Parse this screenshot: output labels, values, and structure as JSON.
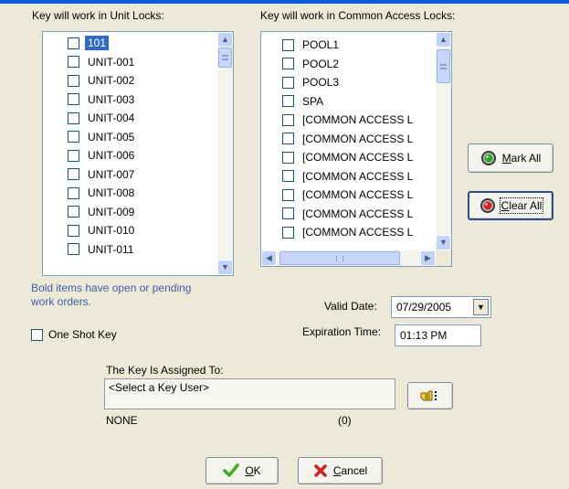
{
  "unit_locks": {
    "heading": "Key will work in Unit Locks:",
    "items": [
      "101",
      "UNIT-001",
      "UNIT-002",
      "UNIT-003",
      "UNIT-004",
      "UNIT-005",
      "UNIT-006",
      "UNIT-007",
      "UNIT-008",
      "UNIT-009",
      "UNIT-010",
      "UNIT-011"
    ],
    "selected": "101"
  },
  "common_locks": {
    "heading": "Key will work in Common Access Locks:",
    "items": [
      "POOL1",
      "POOL2",
      "POOL3",
      "SPA",
      "[COMMON ACCESS L",
      "[COMMON ACCESS L",
      "[COMMON ACCESS L",
      "[COMMON ACCESS L",
      "[COMMON ACCESS L",
      "[COMMON ACCESS L",
      "[COMMON ACCESS L"
    ]
  },
  "note": {
    "line1": "Bold items have open or pending",
    "line2": "work orders."
  },
  "one_shot_key": {
    "label": "One Shot Key",
    "checked": false
  },
  "valid_date": {
    "label": "Valid Date:",
    "value": "07/29/2005"
  },
  "expiration_time": {
    "label": "Expiration Time:",
    "value": "01:13 PM"
  },
  "assignment": {
    "heading": "The Key Is Assigned To:",
    "placeholder": "<Select a Key User>",
    "user_name": "NONE",
    "user_count": "(0)"
  },
  "buttons": {
    "mark_all": {
      "mnemonic": "M",
      "rest": "ark All"
    },
    "clear_all": {
      "mnemonic": "C",
      "rest": "lear All"
    },
    "ok": {
      "mnemonic": "O",
      "rest": "K"
    },
    "cancel": {
      "mnemonic": "C",
      "rest": "ancel"
    }
  },
  "colors": {
    "title_bar": "#0A5ED7",
    "dialog_bg": "#ECE9D8",
    "selection": "#316AC5",
    "note_text": "#3F5FA8",
    "ok_check": "#3DAA1F",
    "cancel_x": "#D3231E"
  }
}
